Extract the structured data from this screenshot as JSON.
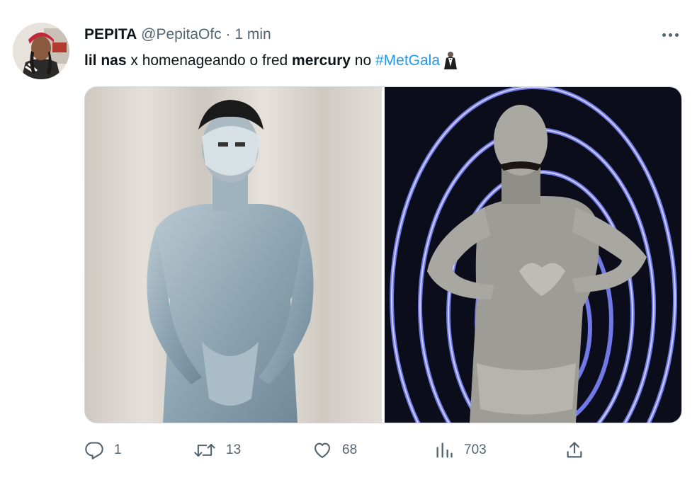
{
  "tweet": {
    "author_name": "PEPITA",
    "author_handle": "@PepitaOfc",
    "separator": "·",
    "time": "1 min",
    "text_parts": {
      "part1": "lil nas",
      "part2": " x homenageando o fred ",
      "part3": "mercury",
      "part4": " no ",
      "hashtag": "#MetGala"
    },
    "emoji": "tuxedo-icon"
  },
  "media": {
    "left_photo": "lil-nas-x-crystal-bodysuit-photo",
    "right_photo": "silver-bodypaint-heart-hands-photo"
  },
  "actions": {
    "replies": "1",
    "retweets": "13",
    "likes": "68",
    "views": "703"
  },
  "colors": {
    "text": "#0f1419",
    "secondary": "#536471",
    "link": "#1d9bf0",
    "border": "#cfd9de"
  }
}
